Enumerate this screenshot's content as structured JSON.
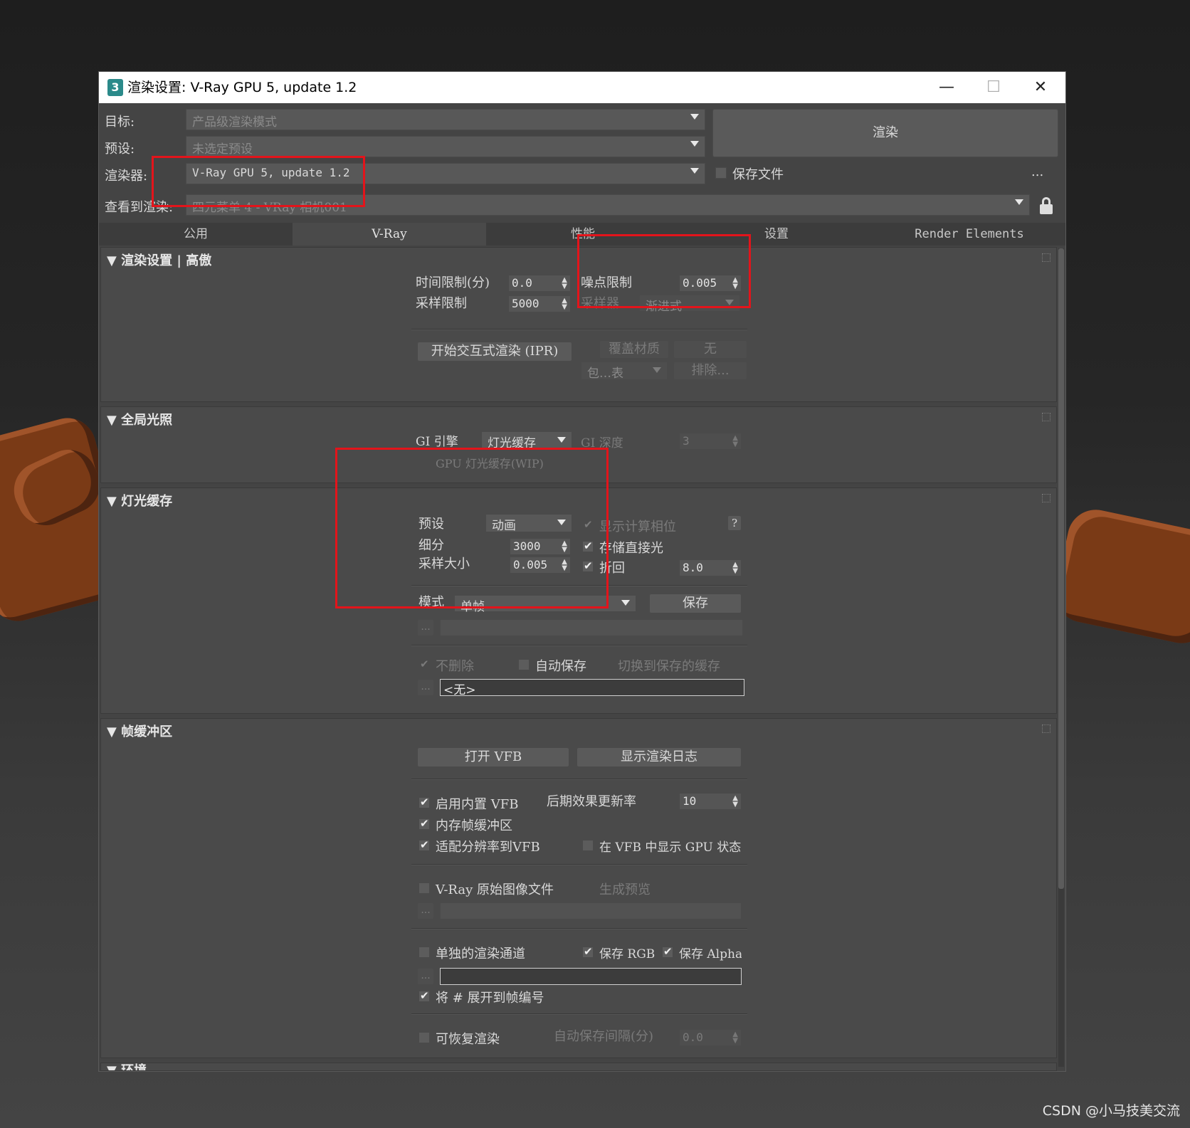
{
  "window": {
    "icon": "3",
    "title": "渲染设置: V-Ray GPU 5, update 1.2",
    "minimize": "—",
    "maximize": "☐",
    "close": "✕"
  },
  "top": {
    "target_label": "目标:",
    "target_value": "产品级渲染模式",
    "preset_label": "预设:",
    "preset_value": "未选定预设",
    "renderer_label": "渲染器:",
    "renderer_value": "V-Ray GPU 5, update 1.2",
    "view_label": "查看到渲染:",
    "view_value": "四元菜单 4 - VRay 相机001",
    "render_button": "渲染",
    "save_file_label": "保存文件",
    "more": "..."
  },
  "tabs": [
    "公用",
    "V-Ray",
    "性能",
    "设置",
    "Render Elements"
  ],
  "render_settings": {
    "title": "渲染设置 | 高傲",
    "time_limit_label": "时间限制(分)",
    "time_limit_value": "0.0",
    "noise_limit_label": "噪点限制",
    "noise_limit_value": "0.005",
    "sample_limit_label": "采样限制",
    "sample_limit_value": "5000",
    "sampler_label": "采样器",
    "sampler_value": "渐进式",
    "ipr_button": "开始交互式渲染 (IPR)",
    "override_mtl_label": "覆盖材质",
    "override_mtl_value": "无",
    "include_list": "包…表",
    "exclude_button": "排除..."
  },
  "gi": {
    "title": "全局光照",
    "engine_label": "GI 引擎",
    "engine_value": "灯光缓存",
    "depth_label": "GI 深度",
    "depth_value": "3",
    "gpu_lc_label": "GPU 灯光缓存(WIP)"
  },
  "light_cache": {
    "title": "灯光缓存",
    "preset_label": "预设",
    "preset_value": "动画",
    "show_calc_label": "显示计算相位",
    "help": "?",
    "subdivs_label": "细分",
    "subdivs_value": "3000",
    "store_direct_label": "存储直接光",
    "sample_size_label": "采样大小",
    "sample_size_value": "0.005",
    "retrace_label": "折回",
    "retrace_value": "8.0",
    "mode_label": "模式",
    "mode_value": "单帧",
    "save_button": "保存",
    "browse": "...",
    "dont_delete_label": "不删除",
    "auto_save_label": "自动保存",
    "switch_saved_label": "切换到保存的缓存",
    "file_value": "<无>"
  },
  "frame_buffer": {
    "title": "帧缓冲区",
    "open_vfb_button": "打开 VFB",
    "show_log_button": "显示渲染日志",
    "enable_vfb_label": "启用内置 VFB",
    "post_update_label": "后期效果更新率",
    "post_update_value": "10",
    "memory_fb_label": "内存帧缓冲区",
    "fit_res_label": "适配分辨率到VFB",
    "show_gpu_label": "在 VFB 中显示 GPU 状态",
    "raw_image_label": "V-Ray 原始图像文件",
    "gen_preview_label": "生成预览",
    "separate_channels_label": "单独的渲染通道",
    "save_rgb_label": "保存 RGB",
    "save_alpha_label": "保存 Alpha",
    "expand_frame_label": "将 # 展开到帧编号",
    "resumable_label": "可恢复渲染",
    "autosave_interval_label": "自动保存间隔(分)",
    "autosave_interval_value": "0.0"
  },
  "environment": {
    "title": "环境"
  },
  "watermark": "CSDN @小马技美交流",
  "colors": {
    "highlight": "#e3141b",
    "panel": "#444444"
  }
}
